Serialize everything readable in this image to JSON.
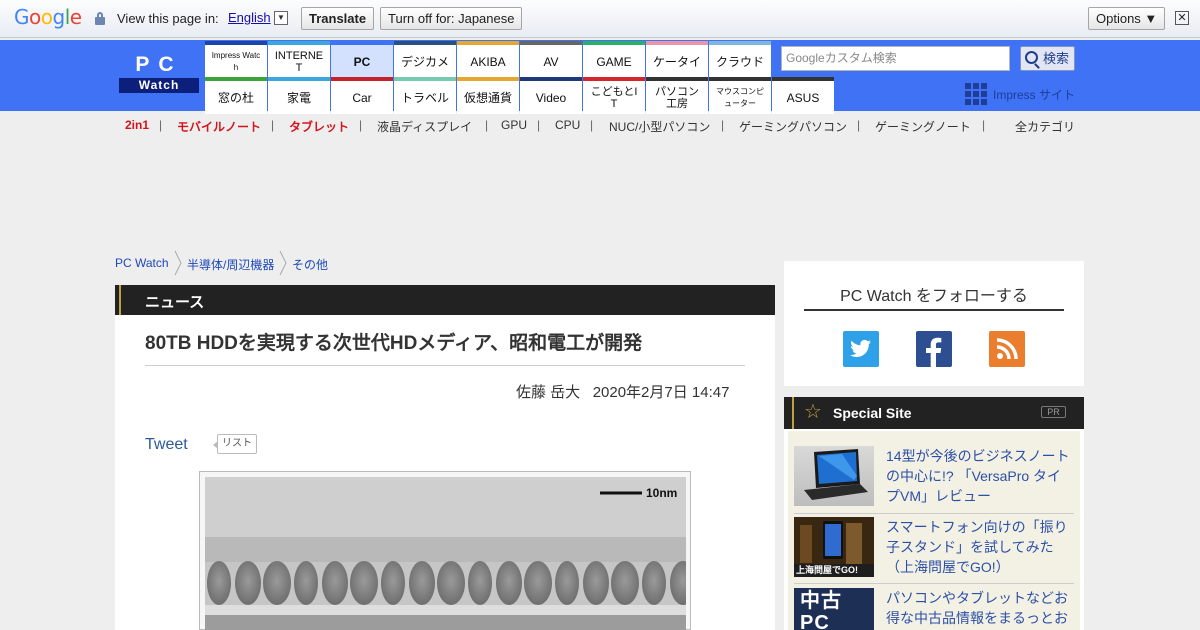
{
  "translate_bar": {
    "logo_letters": [
      "G",
      "o",
      "o",
      "g",
      "l",
      "e"
    ],
    "logo_colors": [
      "#4285f4",
      "#ea4335",
      "#fbbc05",
      "#4285f4",
      "#34a853",
      "#ea4335"
    ],
    "view_text": "View this page in:",
    "language": "English",
    "translate_label": "Translate",
    "turn_off_label": "Turn off for: Japanese",
    "options_label": "Options ▼",
    "close_glyph": "✕"
  },
  "header": {
    "logo_top": "PC",
    "logo_bottom": "Watch",
    "nav_top": [
      {
        "label": "Impress Watch",
        "color": "#1e44a8"
      },
      {
        "label": "INTERNET",
        "color": "#3ba7de"
      },
      {
        "label": "PC",
        "color": "#3f72f5",
        "selected": true
      },
      {
        "label": "デジカメ",
        "color": "#2b4f7c"
      },
      {
        "label": "AKIBA",
        "color": "#e3a830"
      },
      {
        "label": "AV",
        "color": "#666666"
      },
      {
        "label": "GAME",
        "color": "#2dae6d"
      },
      {
        "label": "ケータイ",
        "color": "#e897a8"
      },
      {
        "label": "クラウド",
        "color": "#7eb6df"
      }
    ],
    "nav_bottom": [
      {
        "label": "窓の杜",
        "color": "#3aa33a"
      },
      {
        "label": "家電",
        "color": "#3ba7de"
      },
      {
        "label": "Car",
        "color": "#c3222a"
      },
      {
        "label": "トラベル",
        "color": "#77c9b2"
      },
      {
        "label": "仮想通貨",
        "color": "#e3a830"
      },
      {
        "label": "Video",
        "color": "#1e3a7a"
      },
      {
        "label": "こどもとIT",
        "color": "#d2262e"
      },
      {
        "label": "パソコン工房",
        "color": "#333333"
      },
      {
        "label": "マウスコンピューター",
        "color": "#333333"
      },
      {
        "label": "ASUS",
        "color": "#333333"
      }
    ],
    "search_placeholder": "Googleカスタム検索",
    "search_button": "検索",
    "impress_site": "Impress サイト"
  },
  "subnav": [
    {
      "label": "2in1",
      "red": true
    },
    {
      "label": "モバイルノート",
      "red": true
    },
    {
      "label": "タブレット",
      "red": true
    },
    {
      "label": "液晶ディスプレイ",
      "red": false
    },
    {
      "label": "GPU",
      "red": false
    },
    {
      "label": "CPU",
      "red": false
    },
    {
      "label": "NUC/小型パソコン",
      "red": false
    },
    {
      "label": "ゲーミングパソコン",
      "red": false
    },
    {
      "label": "ゲーミングノート",
      "red": false
    }
  ],
  "subnav_all": "全カテゴリ",
  "breadcrumb": [
    "PC Watch",
    "半導体/周辺機器",
    "その他"
  ],
  "article": {
    "section": "ニュース",
    "title": "80TB HDDを実現する次世代HDメディア、昭和電工が開発",
    "author": "佐藤 岳大",
    "date": "2020年2月7日 14:47",
    "tweet": "Tweet",
    "list_button": "リスト",
    "scale_label": "10nm"
  },
  "sidebar": {
    "follow_title": "PC Watch をフォローする",
    "social": [
      {
        "name": "twitter",
        "color": "#2ea1e8"
      },
      {
        "name": "facebook",
        "color": "#2d4f92"
      },
      {
        "name": "rss",
        "color": "#ea7e2e"
      }
    ],
    "special_title": "Special Site",
    "pr_label": "PR",
    "items": [
      {
        "text": "14型が今後のビジネスノートの中心に!? 「VersaPro タイプVM」レビュー"
      },
      {
        "text": "スマートフォン向けの「振り子スタンド」を試してみた（上海問屋でGO!）",
        "thumb_caption": "上海問屋でGO!"
      },
      {
        "text": "パソコンやタブレットなどお得な中古品情報をまるっとお",
        "thumb_caption": "中古PC"
      }
    ]
  }
}
